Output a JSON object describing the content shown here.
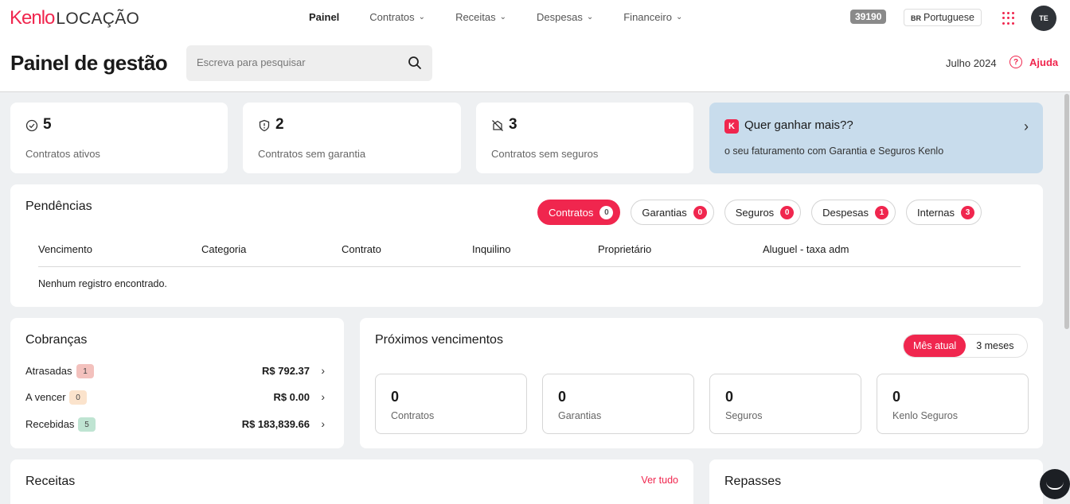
{
  "brand": {
    "name": "Kenlo",
    "product": "LOCAÇÃO"
  },
  "nav": {
    "items": [
      {
        "label": "Painel"
      },
      {
        "label": "Contratos"
      },
      {
        "label": "Receitas"
      },
      {
        "label": "Despesas"
      },
      {
        "label": "Financeiro"
      }
    ],
    "account_number": "39190",
    "language": {
      "flag": "BR",
      "label": "Portuguese"
    },
    "avatar_initials": "TE"
  },
  "header": {
    "title": "Painel de gestão",
    "search_placeholder": "Escreva para pesquisar",
    "period": "Julho 2024",
    "help_label": "Ajuda"
  },
  "stats": [
    {
      "icon": "check-circle-icon",
      "value": "5",
      "label": "Contratos ativos"
    },
    {
      "icon": "shield-icon",
      "value": "2",
      "label": "Contratos sem garantia"
    },
    {
      "icon": "no-insurance-icon",
      "value": "3",
      "label": "Contratos sem seguros"
    }
  ],
  "promo": {
    "badge": "K",
    "title": "Quer ganhar mais??",
    "description": "o seu faturamento com Garantia e Seguros Kenlo"
  },
  "pendencias": {
    "title": "Pendências",
    "tabs": [
      {
        "label": "Contratos",
        "count": "0",
        "active": true
      },
      {
        "label": "Garantias",
        "count": "0"
      },
      {
        "label": "Seguros",
        "count": "0"
      },
      {
        "label": "Despesas",
        "count": "1"
      },
      {
        "label": "Internas",
        "count": "3"
      }
    ],
    "columns": [
      "Vencimento",
      "Categoria",
      "Contrato",
      "Inquilino",
      "Proprietário",
      "Aluguel - taxa adm"
    ],
    "empty_message": "Nenhum registro encontrado."
  },
  "cobrancas": {
    "title": "Cobranças",
    "rows": [
      {
        "label": "Atrasadas",
        "count": "1",
        "amount": "R$ 792.37",
        "color": "#f3c1bd"
      },
      {
        "label": "A vencer",
        "count": "0",
        "amount": "R$ 0.00",
        "color": "#fbe3cc"
      },
      {
        "label": "Recebidas",
        "count": "5",
        "amount": "R$ 183,839.66",
        "color": "#bfe4d2"
      }
    ]
  },
  "proximos": {
    "title": "Próximos vencimentos",
    "toggle": {
      "active": "Mês atual",
      "inactive": "3 meses"
    },
    "boxes": [
      {
        "value": "0",
        "label": "Contratos"
      },
      {
        "value": "0",
        "label": "Garantias"
      },
      {
        "value": "0",
        "label": "Seguros"
      },
      {
        "value": "0",
        "label": "Kenlo Seguros"
      }
    ]
  },
  "receitas": {
    "title": "Receitas",
    "see_all": "Ver tudo"
  },
  "repasses": {
    "title": "Repasses"
  },
  "colors": {
    "accent": "#f0264e",
    "promo_bg": "#c8dcec",
    "page_bg": "#eef0f2"
  }
}
